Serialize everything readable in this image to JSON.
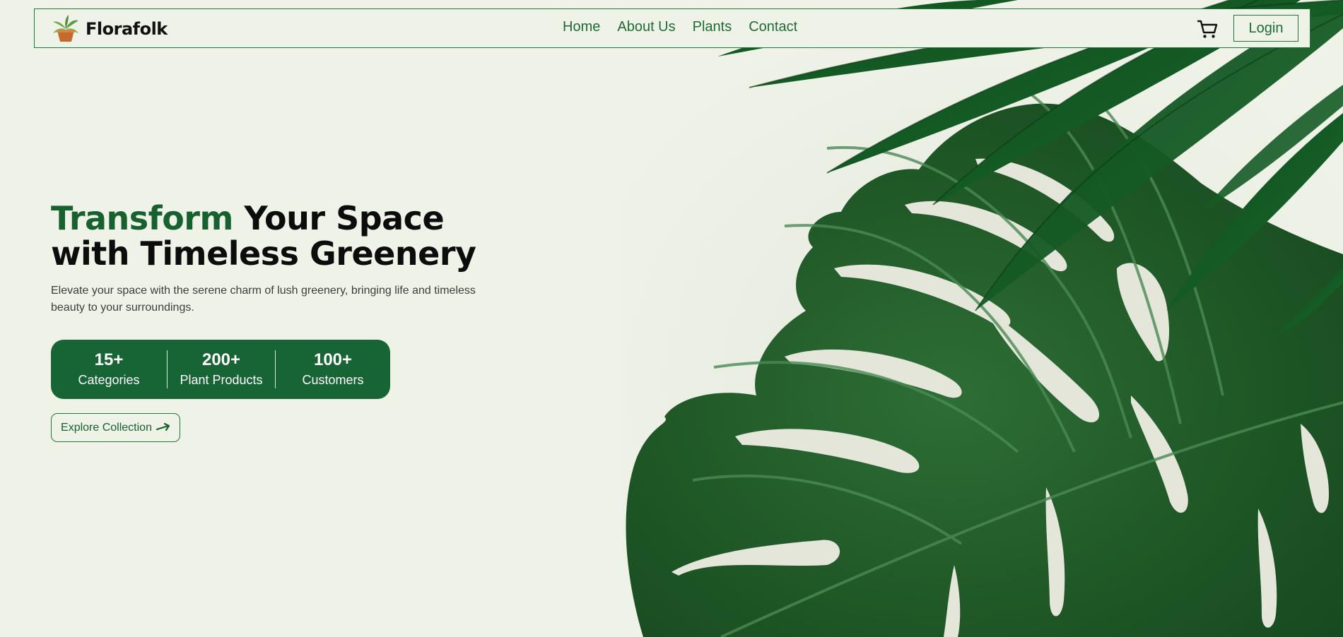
{
  "nav": {
    "brand": "Florafolk",
    "links": [
      "Home",
      "About Us",
      "Plants",
      "Contact"
    ],
    "login_label": "Login"
  },
  "hero": {
    "title_accent": "Transform",
    "title_rest_line1": " Your Space",
    "title_line2": "with Timeless Greenery",
    "description": "Elevate your space with the serene charm of lush greenery, bringing life and timeless beauty to your surroundings.",
    "stats": [
      {
        "value": "15+",
        "label": "Categories"
      },
      {
        "value": "200+",
        "label": "Plant Products"
      },
      {
        "value": "100+",
        "label": "Customers"
      }
    ],
    "cta_label": "Explore Collection"
  },
  "icons": {
    "logo": "potted-plant-icon",
    "cart": "shopping-cart-icon",
    "cta": "arrow-right-icon",
    "hero_image": "monstera-leaf-illustration"
  },
  "colors": {
    "background": "#eff3e7",
    "primary": "#176434",
    "nav_text": "#1e6b35",
    "leaf_dark": "#1f5a29"
  }
}
